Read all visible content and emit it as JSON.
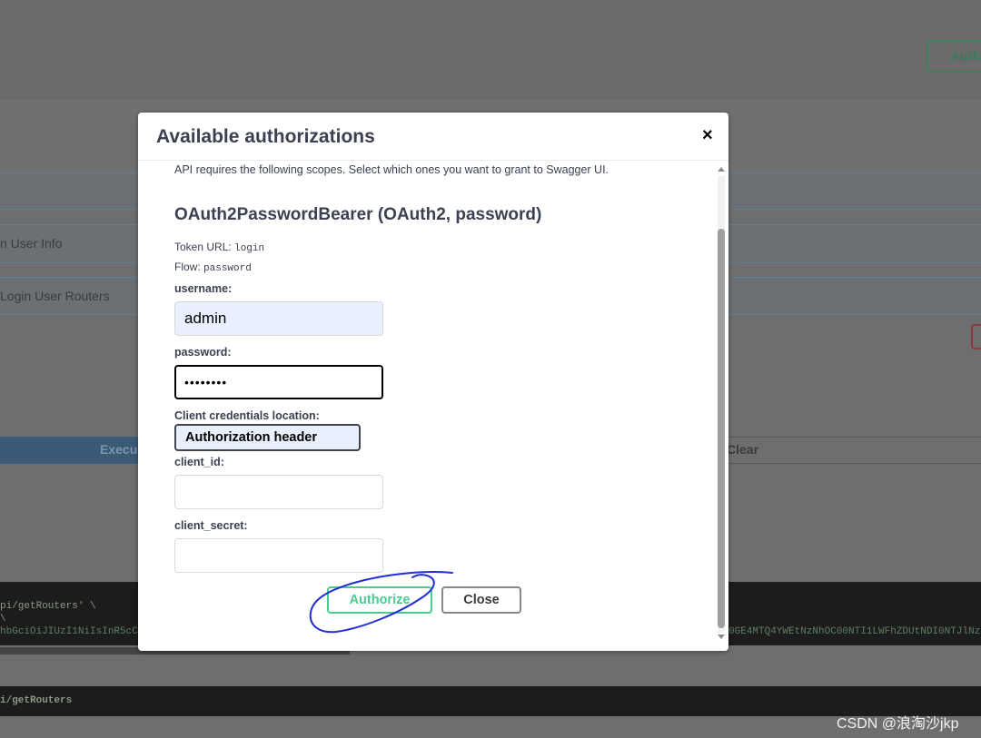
{
  "background": {
    "top_right_button": "Auth",
    "rows": [
      "n User Info",
      "Login User Routers"
    ],
    "execute_label": "Execu",
    "clear_label": "Clear",
    "curl_lines": [
      "pi/getRouters' \\",
      "\\",
      "hbGciOiJIUzI1NiIsInR5cC",
      "0GE4MTQ4YWEtNzNhOC00NTI1LWFhZDUtNDI0NTJlNz"
    ],
    "request_url": "i/getRouters"
  },
  "modal": {
    "title": "Available authorizations",
    "close_icon": "×",
    "scope_note": "API requires the following scopes. Select which ones you want to grant to Swagger UI.",
    "scheme_title": "OAuth2PasswordBearer (OAuth2, password)",
    "token_url_label": "Token URL:",
    "token_url_value": "login",
    "flow_label": "Flow:",
    "flow_value": "password",
    "username_label": "username:",
    "username_value": "admin",
    "password_label": "password:",
    "password_value": "••••••••",
    "client_credentials_label": "Client credentials location:",
    "client_credentials_value": "Authorization header",
    "client_id_label": "client_id:",
    "client_id_value": "",
    "client_secret_label": "client_secret:",
    "client_secret_value": "",
    "authorize_button": "Authorize",
    "close_button": "Close"
  },
  "annotation": {
    "color": "#1f2fd6",
    "icon": "hand-drawn-circle"
  },
  "watermark": "CSDN @浪淘沙jkp"
}
